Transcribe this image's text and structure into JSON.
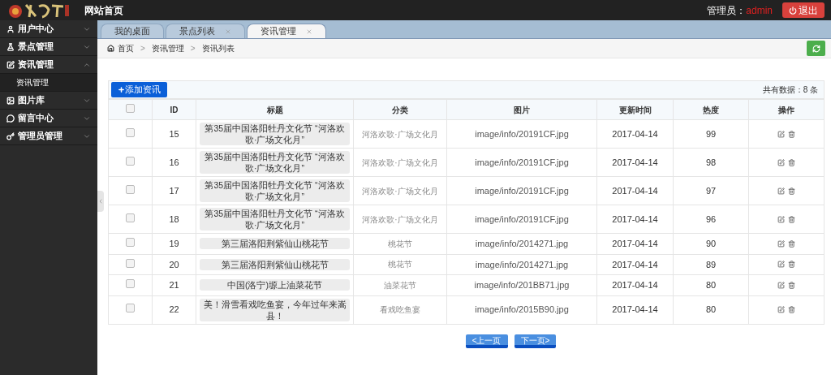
{
  "header": {
    "site_link": "网站首页",
    "admin_label": "管理员：",
    "admin_name": "admin",
    "logout": "退出"
  },
  "sidebar": {
    "items": [
      {
        "label": "用户中心",
        "expanded": false
      },
      {
        "label": "景点管理",
        "expanded": false
      },
      {
        "label": "资讯管理",
        "expanded": true,
        "children": [
          {
            "label": "资讯管理"
          }
        ]
      },
      {
        "label": "图片库",
        "expanded": false
      },
      {
        "label": "留言中心",
        "expanded": false
      },
      {
        "label": "管理员管理",
        "expanded": false
      }
    ]
  },
  "tabs": [
    {
      "label": "我的桌面",
      "selected": false,
      "closable": false
    },
    {
      "label": "景点列表",
      "selected": false,
      "closable": true
    },
    {
      "label": "资讯管理",
      "selected": true,
      "closable": true
    }
  ],
  "breadcrumb": {
    "separator": ">",
    "items": [
      "首页",
      "资讯管理",
      "资讯列表"
    ]
  },
  "toolbar": {
    "add_button": "添加资讯",
    "total": "共有数据：8 条"
  },
  "table": {
    "columns": [
      "ID",
      "标题",
      "分类",
      "图片",
      "更新时间",
      "热度",
      "操作"
    ],
    "header_checked": false,
    "rows": [
      {
        "checked": false,
        "id": "15",
        "title": "第35届中国洛阳牡丹文化节 “河洛欢歌·广场文化月”",
        "category": "河洛欢歌·广场文化月",
        "image": "image/info/20191CF.jpg",
        "updated": "2017-04-14",
        "heat": "99"
      },
      {
        "checked": false,
        "id": "16",
        "title": "第35届中国洛阳牡丹文化节 “河洛欢歌·广场文化月”",
        "category": "河洛欢歌·广场文化月",
        "image": "image/info/20191CF.jpg",
        "updated": "2017-04-14",
        "heat": "98"
      },
      {
        "checked": false,
        "id": "17",
        "title": "第35届中国洛阳牡丹文化节 “河洛欢歌·广场文化月”",
        "category": "河洛欢歌·广场文化月",
        "image": "image/info/20191CF.jpg",
        "updated": "2017-04-14",
        "heat": "97"
      },
      {
        "checked": false,
        "id": "18",
        "title": "第35届中国洛阳牡丹文化节 “河洛欢歌·广场文化月”",
        "category": "河洛欢歌·广场文化月",
        "image": "image/info/20191CF.jpg",
        "updated": "2017-04-14",
        "heat": "96"
      },
      {
        "checked": false,
        "id": "19",
        "title": "第三届洛阳荆紫仙山桃花节",
        "category": "桃花节",
        "image": "image/info/2014271.jpg",
        "updated": "2017-04-14",
        "heat": "90"
      },
      {
        "checked": false,
        "id": "20",
        "title": "第三届洛阳荆紫仙山桃花节",
        "category": "桃花节",
        "image": "image/info/2014271.jpg",
        "updated": "2017-04-14",
        "heat": "89"
      },
      {
        "checked": false,
        "id": "21",
        "title": "中国(洛宁)塬上油菜花节",
        "category": "油菜花节",
        "image": "image/info/201BB71.jpg",
        "updated": "2017-04-14",
        "heat": "80"
      },
      {
        "checked": false,
        "id": "22",
        "title": "美！滑雪看戏吃鱼宴，今年过年来嵩县！",
        "category": "看戏吃鱼宴",
        "image": "image/info/2015B90.jpg",
        "updated": "2017-04-14",
        "heat": "80"
      }
    ]
  },
  "pagination": {
    "prev": "<上一页",
    "next": "下一页>"
  }
}
